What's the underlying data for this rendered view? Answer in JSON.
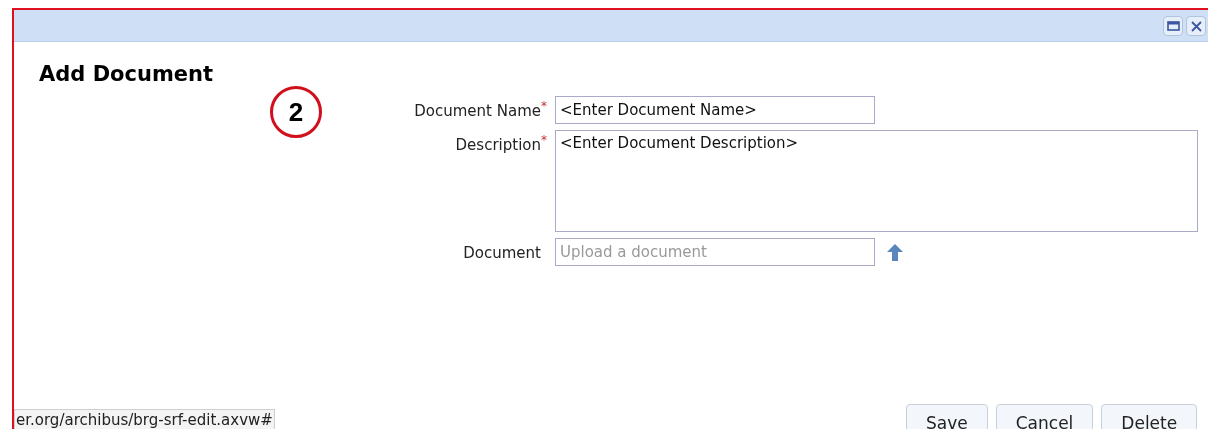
{
  "dialog": {
    "title": "Add Document",
    "annotation": "2"
  },
  "fields": [
    {
      "label": "Document Name",
      "required_mark": "*",
      "kind": "input",
      "value": "<Enter Document Name>"
    },
    {
      "label": "Description",
      "required_mark": "*",
      "kind": "textarea",
      "value": "<Enter Document Description>"
    },
    {
      "label": "Document",
      "kind": "upload",
      "placeholder": "Upload a document"
    }
  ],
  "buttons": [
    "Save",
    "Cancel",
    "Delete"
  ],
  "status_url": "er.org/archibus/brg-srf-edit.axvw#"
}
